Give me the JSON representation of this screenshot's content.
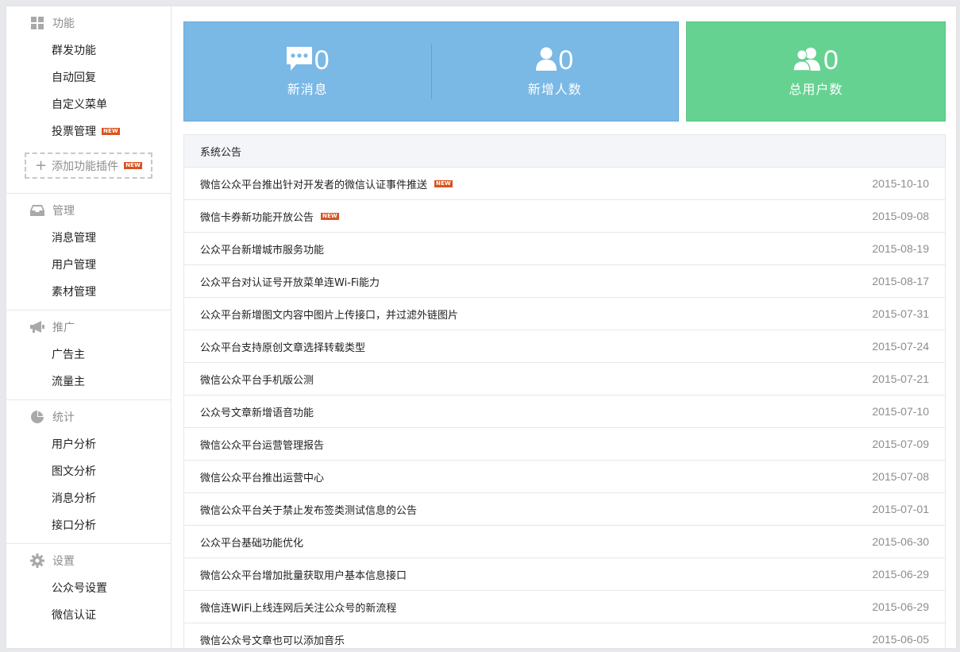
{
  "sidebar": {
    "sections": [
      {
        "title": "功能",
        "icon": "grid-icon",
        "items": [
          "群发功能",
          "自动回复",
          "自定义菜单",
          "投票管理"
        ]
      },
      {
        "title": "管理",
        "icon": "inbox-icon",
        "items": [
          "消息管理",
          "用户管理",
          "素材管理"
        ]
      },
      {
        "title": "推广",
        "icon": "megaphone-icon",
        "items": [
          "广告主",
          "流量主"
        ]
      },
      {
        "title": "统计",
        "icon": "pie-chart-icon",
        "items": [
          "用户分析",
          "图文分析",
          "消息分析",
          "接口分析"
        ]
      },
      {
        "title": "设置",
        "icon": "gear-icon",
        "items": [
          "公众号设置",
          "微信认证"
        ]
      }
    ],
    "new_tag": "NEW",
    "add_plugin_label": "添加功能插件"
  },
  "stats": {
    "new_messages": {
      "value": "0",
      "label": "新消息",
      "icon": "chat-icon"
    },
    "new_users": {
      "value": "0",
      "label": "新增人数",
      "icon": "user-icon"
    },
    "total_users": {
      "value": "0",
      "label": "总用户数",
      "icon": "users-icon"
    },
    "colors": {
      "blue": "#7ab8e6",
      "green": "#66d292"
    }
  },
  "notices": {
    "title": "系统公告",
    "rows": [
      {
        "title": "微信公众平台推出针对开发者的微信认证事件推送",
        "date": "2015-10-10",
        "is_new": true
      },
      {
        "title": "微信卡券新功能开放公告",
        "date": "2015-09-08",
        "is_new": true
      },
      {
        "title": "公众平台新增城市服务功能",
        "date": "2015-08-19",
        "is_new": false
      },
      {
        "title": "公众平台对认证号开放菜单连Wi-Fi能力",
        "date": "2015-08-17",
        "is_new": false
      },
      {
        "title": "公众平台新增图文内容中图片上传接口，并过滤外链图片",
        "date": "2015-07-31",
        "is_new": false
      },
      {
        "title": "公众平台支持原创文章选择转载类型",
        "date": "2015-07-24",
        "is_new": false
      },
      {
        "title": "微信公众平台手机版公测",
        "date": "2015-07-21",
        "is_new": false
      },
      {
        "title": "公众号文章新增语音功能",
        "date": "2015-07-10",
        "is_new": false
      },
      {
        "title": "微信公众平台运营管理报告",
        "date": "2015-07-09",
        "is_new": false
      },
      {
        "title": "微信公众平台推出运营中心",
        "date": "2015-07-08",
        "is_new": false
      },
      {
        "title": "微信公众平台关于禁止发布签类测试信息的公告",
        "date": "2015-07-01",
        "is_new": false
      },
      {
        "title": "公众平台基础功能优化",
        "date": "2015-06-30",
        "is_new": false
      },
      {
        "title": "微信公众平台增加批量获取用户基本信息接口",
        "date": "2015-06-29",
        "is_new": false
      },
      {
        "title": "微信连WiFi上线连网后关注公众号的新流程",
        "date": "2015-06-29",
        "is_new": false
      },
      {
        "title": "微信公众号文章也可以添加音乐",
        "date": "2015-06-05",
        "is_new": false
      }
    ]
  }
}
